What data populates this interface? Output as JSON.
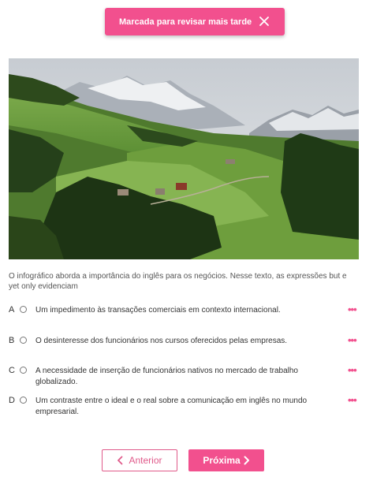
{
  "toast": {
    "message": "Marcada para revisar mais tarde",
    "close_icon": "close-icon"
  },
  "question": {
    "prompt": "O infográfico aborda a importância do inglês para os negócios. Nesse texto, as expressões but e yet only evidenciam",
    "options": [
      {
        "letter": "A",
        "text": "Um impedimento às transações comerciais em contexto internacional."
      },
      {
        "letter": "B",
        "text": "O desinteresse dos funcionários nos cursos oferecidos pelas empresas."
      },
      {
        "letter": "C",
        "text": "A necessidade de inserção de funcionários nativos no mercado de trabalho globalizado."
      },
      {
        "letter": "D",
        "text": "Um contraste entre o ideal e o real sobre a comunicação em inglês no mundo empresarial."
      }
    ],
    "more_icon": "more-horizontal-icon"
  },
  "nav": {
    "prev_label": "Anterior",
    "next_label": "Próxima"
  },
  "colors": {
    "accent": "#f2508e"
  }
}
